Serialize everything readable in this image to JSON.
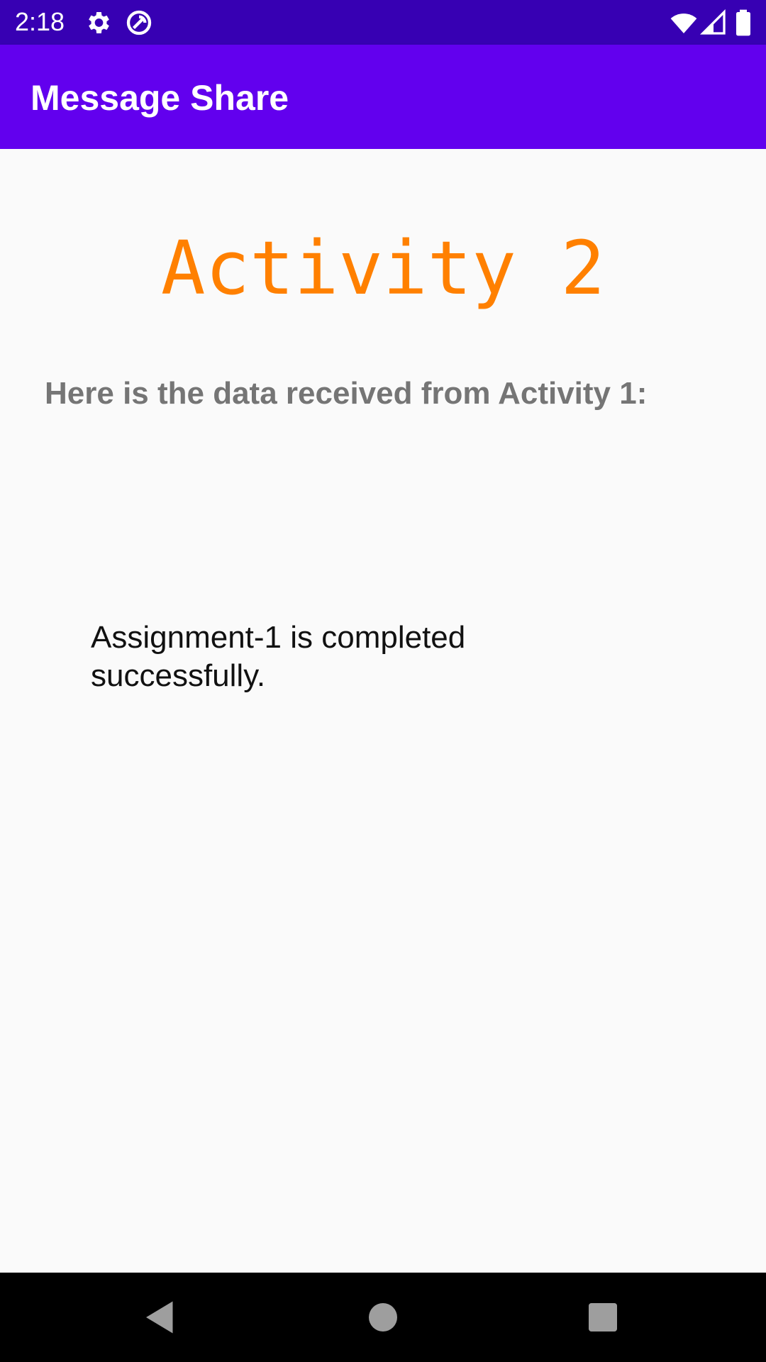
{
  "status_bar": {
    "time": "2:18",
    "background": "#3700b3",
    "icons": [
      "gear-icon",
      "data-saver-icon",
      "wifi-icon",
      "signal-icon",
      "battery-icon"
    ]
  },
  "app_bar": {
    "title": "Message Share",
    "background": "#6200ee"
  },
  "main": {
    "heading": "Activity 2",
    "heading_color": "#ff8000",
    "received_label": "Here is the data received from Activity 1:",
    "message": "Assignment-1 is completed successfully."
  },
  "nav_bar": {
    "buttons": [
      "back-icon",
      "home-icon",
      "recents-icon"
    ]
  }
}
